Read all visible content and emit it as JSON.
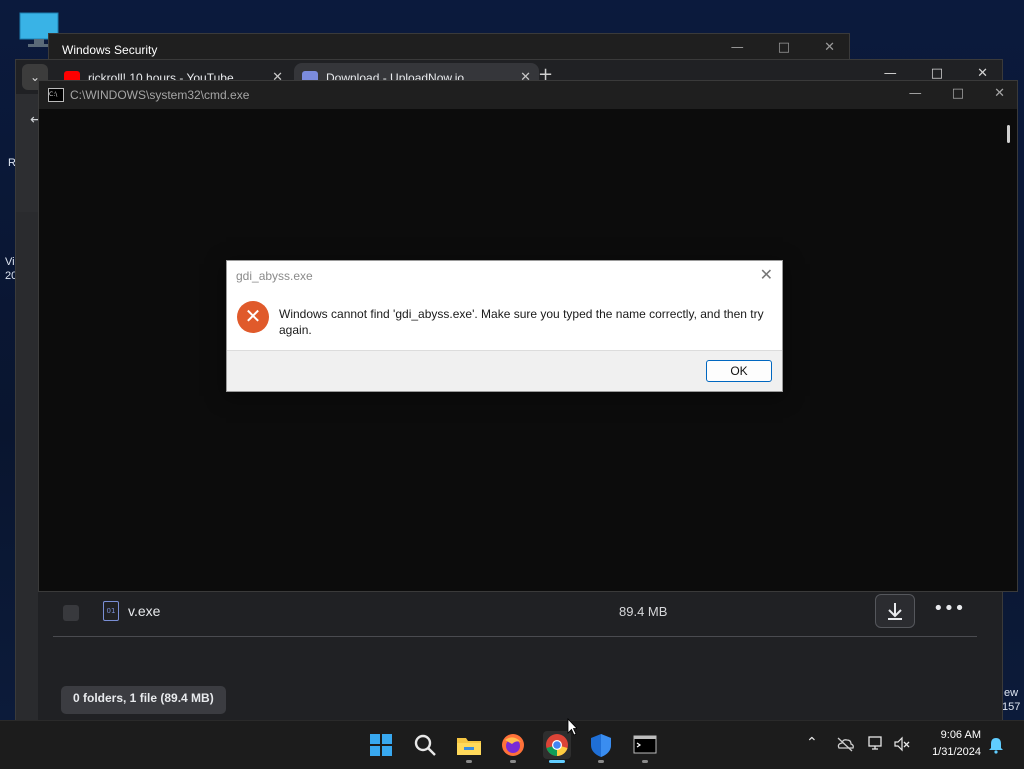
{
  "desktop": {
    "edge_texts": [
      "R",
      "Vi",
      "20",
      "ew",
      "157"
    ]
  },
  "windows_security": {
    "title": "Windows Security"
  },
  "browser": {
    "tabs": [
      {
        "label": "rickroll! 10 hours - YouTube",
        "icon": "youtube-icon"
      },
      {
        "label": "Download - UploadNow.io",
        "icon": "page-icon"
      }
    ],
    "download": {
      "file_name": "v.exe",
      "file_size": "89.4 MB",
      "summary": "0 folders, 1 file (89.4 MB)"
    }
  },
  "cmd": {
    "title": "C:\\WINDOWS\\system32\\cmd.exe"
  },
  "dialog": {
    "title": "gdi_abyss.exe",
    "message": "Windows cannot find 'gdi_abyss.exe'. Make sure you typed the name correctly, and then try again.",
    "ok_label": "OK"
  },
  "taskbar": {
    "time": "9:06 AM",
    "date": "1/31/2024",
    "apps": [
      "start-icon",
      "search-icon",
      "file-explorer-icon",
      "firefox-icon",
      "chrome-icon",
      "windows-security-icon",
      "terminal-icon"
    ]
  },
  "colors": {
    "accent_blue": "#0067c0",
    "error_red": "#e05a2b",
    "taskbar_active": "#60cdff"
  }
}
